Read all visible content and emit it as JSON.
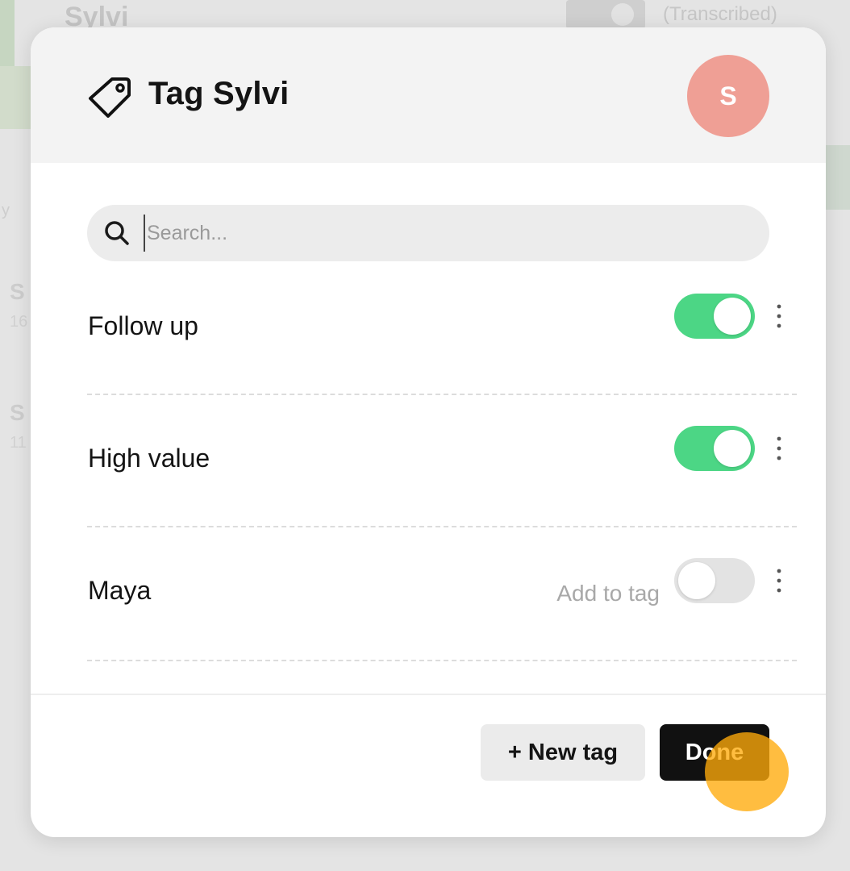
{
  "background": {
    "title": "Sylvi",
    "status": "(Transcribed)",
    "list_initial_a": "S",
    "list_sub_a": "16",
    "list_initial_b": "S",
    "list_sub_b": "11",
    "side_char": "y"
  },
  "modal": {
    "title": "Tag Sylvi",
    "avatar_initial": "S",
    "avatar_color": "#ef9f95",
    "title_icon": "tag-icon"
  },
  "search": {
    "placeholder": "Search...",
    "value": ""
  },
  "tags": [
    {
      "name": "Follow up",
      "enabled": true,
      "hint": ""
    },
    {
      "name": "High value",
      "enabled": true,
      "hint": ""
    },
    {
      "name": "Maya",
      "enabled": false,
      "hint": "Add to tag"
    }
  ],
  "footer": {
    "new_tag_label": "+ New tag",
    "done_label": "Done"
  },
  "colors": {
    "toggle_on": "#4cd685",
    "toggle_off": "#e3e3e3",
    "primary_button": "#111111",
    "cursor_highlight": "#ffaa0a"
  }
}
